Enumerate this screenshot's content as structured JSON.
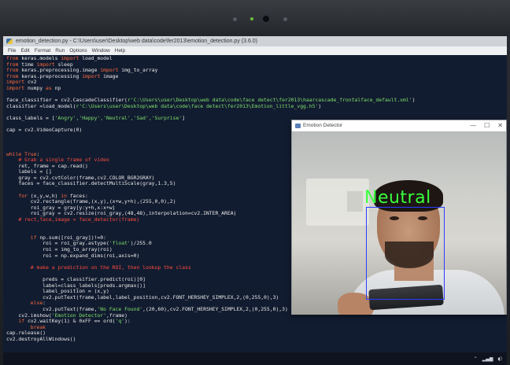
{
  "editor": {
    "title": "emotion_detection.py - C:\\Users\\user\\Desktop\\web data\\code\\fer2013\\emotion_detection.py (3.6.0)",
    "menu": [
      "File",
      "Edit",
      "Format",
      "Run",
      "Options",
      "Window",
      "Help"
    ],
    "code_lines": [
      [
        [
          "kw",
          "from "
        ],
        [
          "fn",
          "keras.models "
        ],
        [
          "kw",
          "import "
        ],
        [
          "fn",
          "load_model"
        ]
      ],
      [
        [
          "kw",
          "from "
        ],
        [
          "fn",
          "time "
        ],
        [
          "kw",
          "import "
        ],
        [
          "fn",
          "sleep"
        ]
      ],
      [
        [
          "kw",
          "from "
        ],
        [
          "fn",
          "keras.preprocessing.image "
        ],
        [
          "kw",
          "import "
        ],
        [
          "fn",
          "img_to_array"
        ]
      ],
      [
        [
          "kw",
          "from "
        ],
        [
          "fn",
          "keras.preprocessing "
        ],
        [
          "kw",
          "import "
        ],
        [
          "fn",
          "image"
        ]
      ],
      [
        [
          "kw",
          "import "
        ],
        [
          "fn",
          "cv2"
        ]
      ],
      [
        [
          "kw",
          "import "
        ],
        [
          "fn",
          "numpy "
        ],
        [
          "kw",
          "as "
        ],
        [
          "fn",
          "np"
        ]
      ],
      [
        [
          "fn",
          ""
        ]
      ],
      [
        [
          "fn",
          "face_classifier = cv2.CascadeClassifier("
        ],
        [
          "str",
          "r'C:\\Users\\user\\Desktop\\web data\\code\\face detect\\fer2013\\haarcascade_frontalface_default.xml'"
        ],
        [
          "fn",
          ")"
        ]
      ],
      [
        [
          "fn",
          "classifier =load_model("
        ],
        [
          "str",
          "r'C:\\Users\\user\\Desktop\\web data\\code\\face detect\\fer2013\\Emotion_little_vgg.h5'"
        ],
        [
          "fn",
          ")"
        ]
      ],
      [
        [
          "fn",
          ""
        ]
      ],
      [
        [
          "fn",
          "class_labels = ["
        ],
        [
          "str",
          "'Angry','Happy','Neutral','Sad','Surprise'"
        ],
        [
          "fn",
          "]"
        ]
      ],
      [
        [
          "fn",
          ""
        ]
      ],
      [
        [
          "fn",
          "cap = cv2.VideoCapture(0)"
        ]
      ],
      [
        [
          "fn",
          ""
        ]
      ],
      [
        [
          "fn",
          ""
        ]
      ],
      [
        [
          "fn",
          ""
        ]
      ],
      [
        [
          "kw",
          "while True"
        ],
        [
          "fn",
          ":"
        ]
      ],
      [
        [
          "cmt",
          "    # Grab a single frame of video"
        ]
      ],
      [
        [
          "fn",
          "    ret, frame = cap.read()"
        ]
      ],
      [
        [
          "fn",
          "    labels = []"
        ]
      ],
      [
        [
          "fn",
          "    gray = cv2.cvtColor(frame,cv2.COLOR_BGR2GRAY)"
        ]
      ],
      [
        [
          "fn",
          "    faces = face_classifier.detectMultiScale(gray,1.3,5)"
        ]
      ],
      [
        [
          "fn",
          ""
        ]
      ],
      [
        [
          "kw",
          "    for "
        ],
        [
          "fn",
          "(x,y,w,h) "
        ],
        [
          "kw",
          "in "
        ],
        [
          "fn",
          "faces:"
        ]
      ],
      [
        [
          "fn",
          "        cv2.rectangle(frame,(x,y),(x+w,y+h),(255,0,0),2)"
        ]
      ],
      [
        [
          "fn",
          "        roi_gray = gray[y:y+h,x:x+w]"
        ]
      ],
      [
        [
          "fn",
          "        roi_gray = cv2.resize(roi_gray,(48,48),interpolation=cv2.INTER_AREA)"
        ]
      ],
      [
        [
          "cmt",
          "    # rect,face,image = face_detector(frame)"
        ]
      ],
      [
        [
          "fn",
          ""
        ]
      ],
      [
        [
          "fn",
          ""
        ]
      ],
      [
        [
          "kw",
          "        if "
        ],
        [
          "fn",
          "np.sum([roi_gray])!=0:"
        ]
      ],
      [
        [
          "fn",
          "            roi = roi_gray.astype("
        ],
        [
          "str",
          "'float'"
        ],
        [
          "fn",
          ")/255.0"
        ]
      ],
      [
        [
          "fn",
          "            roi = img_to_array(roi)"
        ]
      ],
      [
        [
          "fn",
          "            roi = np.expand_dims(roi,axis=0)"
        ]
      ],
      [
        [
          "fn",
          ""
        ]
      ],
      [
        [
          "cmt",
          "        # make a prediction on the ROI, then lookup the class"
        ]
      ],
      [
        [
          "fn",
          ""
        ]
      ],
      [
        [
          "fn",
          "            preds = classifier.predict(roi)[0]"
        ]
      ],
      [
        [
          "fn",
          "            label=class_labels[preds.argmax()]"
        ]
      ],
      [
        [
          "fn",
          "            label_position = (x,y)"
        ]
      ],
      [
        [
          "fn",
          "            cv2.putText(frame,label,label_position,cv2.FONT_HERSHEY_SIMPLEX,2,(0,255,0),3)"
        ]
      ],
      [
        [
          "kw",
          "        else"
        ],
        [
          "fn",
          ":"
        ]
      ],
      [
        [
          "fn",
          "            cv2.putText(frame,"
        ],
        [
          "str",
          "'No Face Found'"
        ],
        [
          "fn",
          ",(20,60),cv2.FONT_HERSHEY_SIMPLEX,2,(0,255,0),3)"
        ]
      ],
      [
        [
          "fn",
          "    cv2.imshow("
        ],
        [
          "str",
          "'Emotion Detector'"
        ],
        [
          "fn",
          ",frame)"
        ]
      ],
      [
        [
          "kw",
          "    if "
        ],
        [
          "fn",
          "cv2.waitKey(1) & 0xFF == ord("
        ],
        [
          "str",
          "'q'"
        ],
        [
          "fn",
          "):"
        ]
      ],
      [
        [
          "kw",
          "        break"
        ]
      ],
      [
        [
          "fn",
          "cap.release()"
        ]
      ],
      [
        [
          "fn",
          "cv2.destroyAllWindows()"
        ]
      ]
    ]
  },
  "emotion_window": {
    "title": "Emotion Detector",
    "controls": {
      "minimize": "—",
      "maximize": "☐",
      "close": "✕"
    },
    "detected_label": "Neutral"
  },
  "colors": {
    "label_green": "#39ff3c",
    "box_blue": "#2b3cff",
    "keyword": "#ff6a3c",
    "string": "#7fe06a",
    "comment": "#ff4b3e"
  },
  "icons": [
    "python-icon",
    "window-app-icon",
    "tray-chevron-icon",
    "tray-network-icon",
    "tray-volume-icon"
  ]
}
